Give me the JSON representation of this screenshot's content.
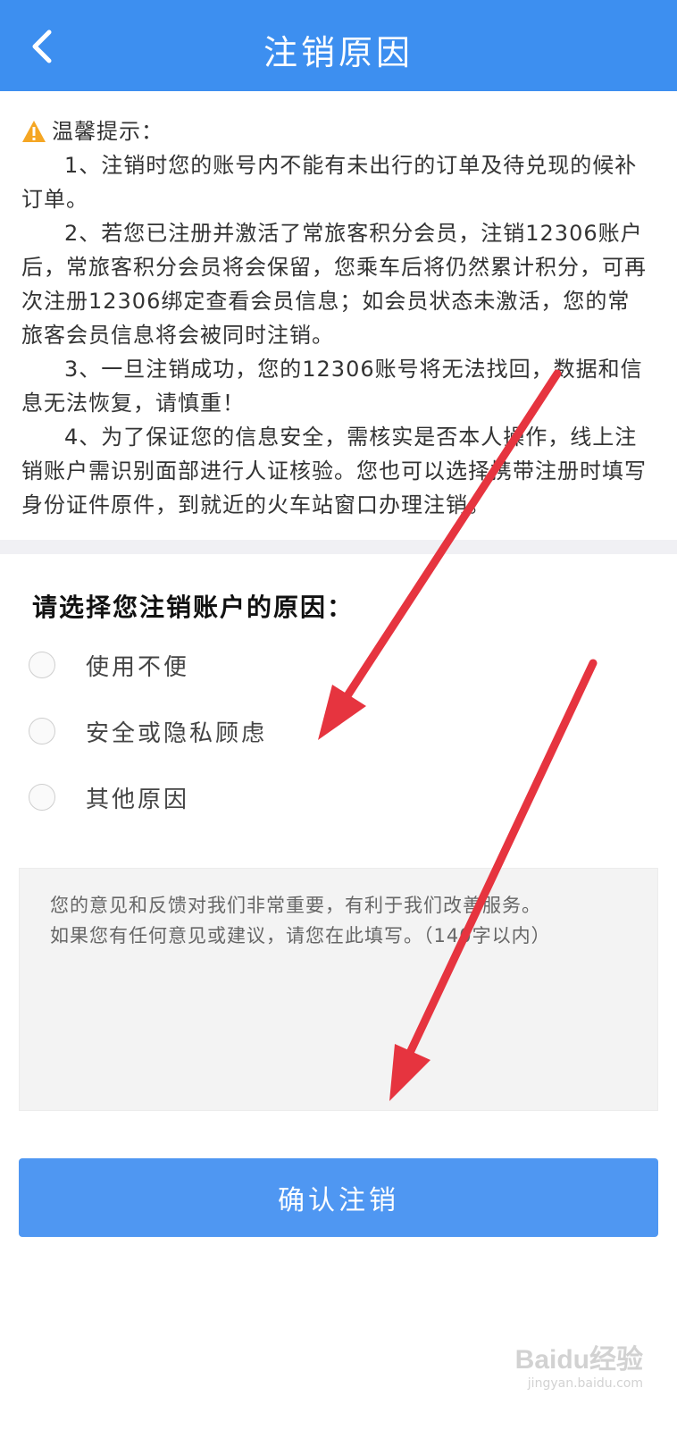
{
  "header": {
    "title": "注销原因",
    "back_icon": "chevron-left-icon"
  },
  "notice": {
    "icon": "warning-icon",
    "heading": "温馨提示：",
    "items": [
      "1、注销时您的账号内不能有未出行的订单及待兑现的候补订单。",
      "2、若您已注册并激活了常旅客积分会员，注销12306账户后，常旅客积分会员将会保留，您乘车后将仍然累计积分，可再次注册12306绑定查看会员信息；如会员状态未激活，您的常旅客会员信息将会被同时注销。",
      "3、一旦注销成功，您的12306账号将无法找回，数据和信息无法恢复，请慎重！",
      "4、为了保证您的信息安全，需核实是否本人操作，线上注销账户需识别面部进行人证核验。您也可以选择携带注册时填写身份证件原件，到就近的火车站窗口办理注销。"
    ]
  },
  "reasons": {
    "title": "请选择您注销账户的原因：",
    "options": [
      "使用不便",
      "安全或隐私顾虑",
      "其他原因"
    ]
  },
  "feedback": {
    "placeholder": "您的意见和反馈对我们非常重要，有利于我们改善服务。\n如果您有任何意见或建议，请您在此填写。（140字以内）",
    "value": ""
  },
  "confirm_button": {
    "label": "确认注销"
  },
  "colors": {
    "header_bg": "#3d8ff0",
    "button_bg": "#4f97f2",
    "annotation_arrow": "#e6343f",
    "warning": "#f5a623"
  },
  "watermark": {
    "logo": "Baidu经验",
    "url": "jingyan.baidu.com"
  }
}
